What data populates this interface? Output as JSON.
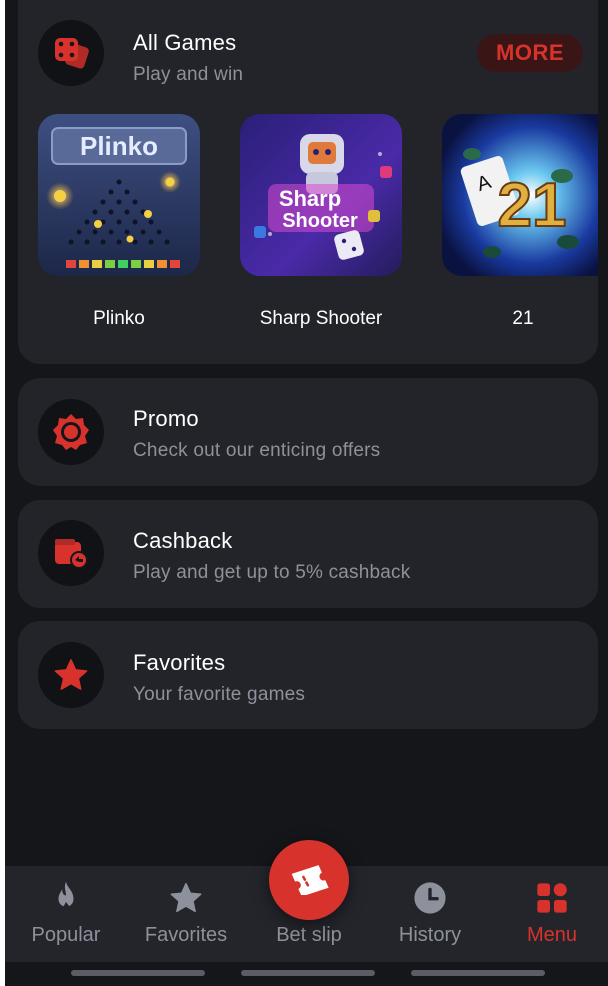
{
  "all_games": {
    "title": "All Games",
    "subtitle": "Play and win",
    "more_label": "MORE",
    "icon": "dice-icon",
    "games": [
      {
        "label": "Plinko",
        "logo_text": "Plinko",
        "thumb": "plinko-thumbnail"
      },
      {
        "label": "Sharp Shooter",
        "logo_line1": "Sharp",
        "logo_line2": "Shooter",
        "thumb": "sharp-shooter-thumbnail"
      },
      {
        "label": "21",
        "logo_text": "21",
        "thumb": "blackjack-21-thumbnail"
      }
    ]
  },
  "menu_rows": [
    {
      "title": "Promo",
      "subtitle": "Check out our enticing offers",
      "icon": "promo-badge-icon"
    },
    {
      "title": "Cashback",
      "subtitle": "Play and get up to 5% cashback",
      "icon": "cashback-wallet-icon"
    },
    {
      "title": "Favorites",
      "subtitle": "Your favorite games",
      "icon": "star-icon"
    }
  ],
  "bottom_nav": {
    "items": [
      {
        "label": "Popular",
        "icon": "flame-icon",
        "active": false
      },
      {
        "label": "Favorites",
        "icon": "star-icon",
        "active": false
      },
      {
        "label": "Bet slip",
        "icon": "ticket-icon",
        "active": false
      },
      {
        "label": "History",
        "icon": "clock-icon",
        "active": false
      },
      {
        "label": "Menu",
        "icon": "grid-icon",
        "active": true
      }
    ]
  },
  "colors": {
    "accent": "#d8322d",
    "background": "#151619",
    "card": "#22242a",
    "muted_text": "#8d919b"
  }
}
